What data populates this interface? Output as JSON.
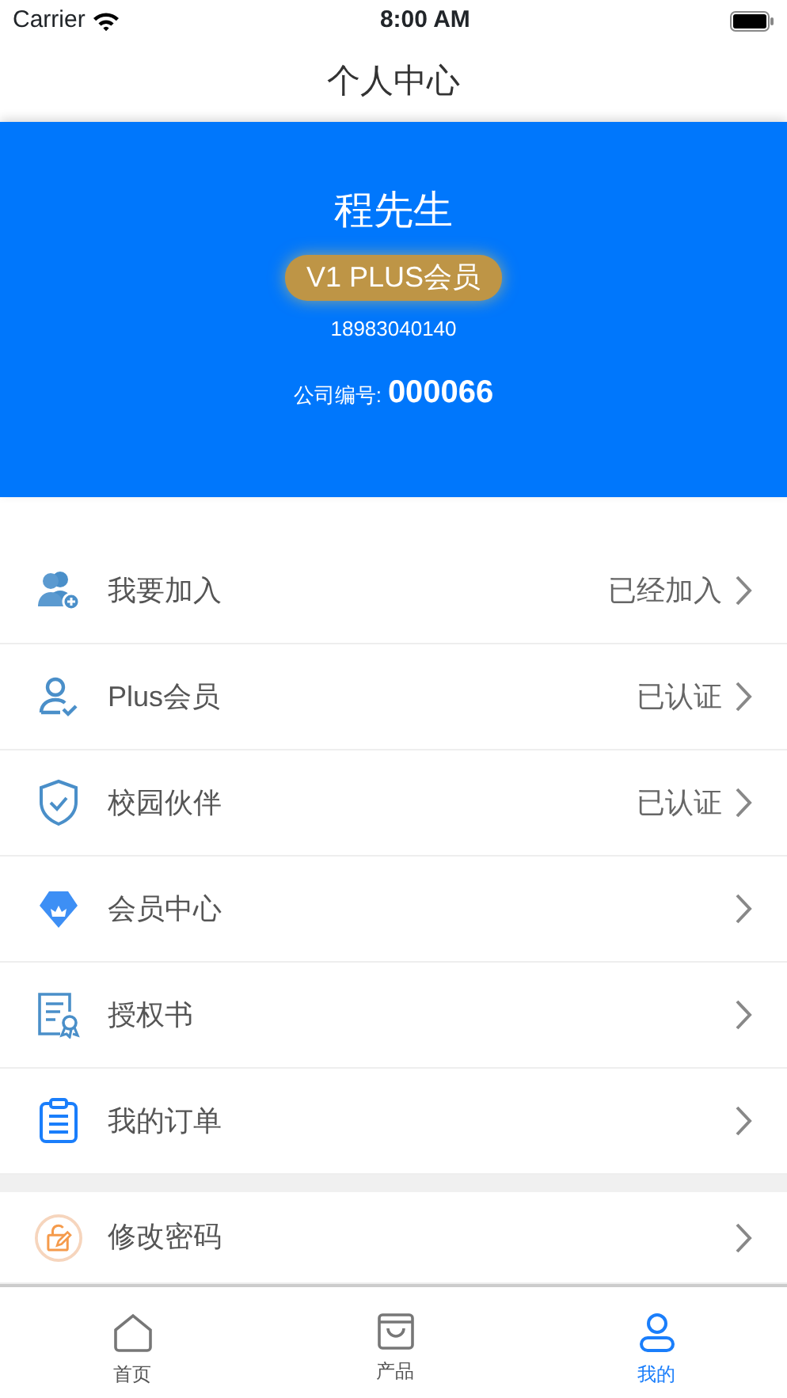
{
  "status_bar": {
    "carrier": "Carrier",
    "time": "8:00 AM"
  },
  "nav_bar": {
    "title": "个人中心"
  },
  "profile": {
    "name": "程先生",
    "member_badge": "V1 PLUS会员",
    "phone": "18983040140",
    "company_label": "公司编号:",
    "company_number": "000066"
  },
  "menu_groups": [
    {
      "items": [
        {
          "kind": "join",
          "label": "我要加入",
          "status": "已经加入"
        },
        {
          "kind": "plus",
          "label": "Plus会员",
          "status": "已认证"
        },
        {
          "kind": "campus",
          "label": "校园伙伴",
          "status": "已认证"
        },
        {
          "kind": "member",
          "label": "会员中心"
        },
        {
          "kind": "license",
          "label": "授权书"
        },
        {
          "kind": "orders",
          "label": "我的订单"
        }
      ]
    },
    {
      "items": [
        {
          "kind": "password",
          "label": "修改密码"
        }
      ]
    }
  ],
  "tab_bar": [
    {
      "kind": "home",
      "label": "首页",
      "selected": false
    },
    {
      "kind": "products",
      "label": "产品",
      "selected": false
    },
    {
      "kind": "mine",
      "label": "我的",
      "selected": true
    }
  ]
}
